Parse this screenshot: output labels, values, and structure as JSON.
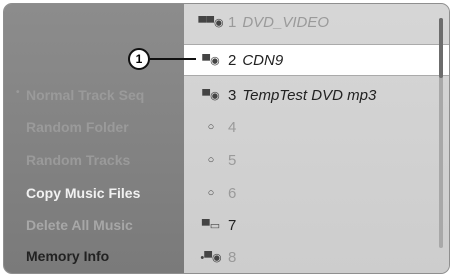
{
  "left_menu": [
    {
      "label": "Normal Track Seq",
      "bullet": "•"
    },
    {
      "label": "Random Folder",
      "bullet": ""
    },
    {
      "label": "Random Tracks",
      "bullet": ""
    },
    {
      "label": "Copy Music Files",
      "bullet": ""
    },
    {
      "label": "Delete All Music",
      "bullet": ""
    },
    {
      "label": "Memory Info",
      "bullet": ""
    }
  ],
  "callout": {
    "label": "1"
  },
  "tracks": [
    {
      "num": "1",
      "label": "DVD_VIDEO",
      "icon": "dvd-icon"
    },
    {
      "num": "2",
      "label": "CDN9",
      "icon": "disc-icon"
    },
    {
      "num": "3",
      "label": "TempTest DVD mp3",
      "icon": "disc-icon"
    },
    {
      "num": "4",
      "label": "",
      "icon": "empty-slot-icon"
    },
    {
      "num": "5",
      "label": "",
      "icon": "empty-slot-icon"
    },
    {
      "num": "6",
      "label": "",
      "icon": "empty-slot-icon"
    },
    {
      "num": "7",
      "label": "",
      "icon": "folder-icon"
    },
    {
      "num": "8",
      "label": "",
      "icon": "disc-icon"
    }
  ]
}
